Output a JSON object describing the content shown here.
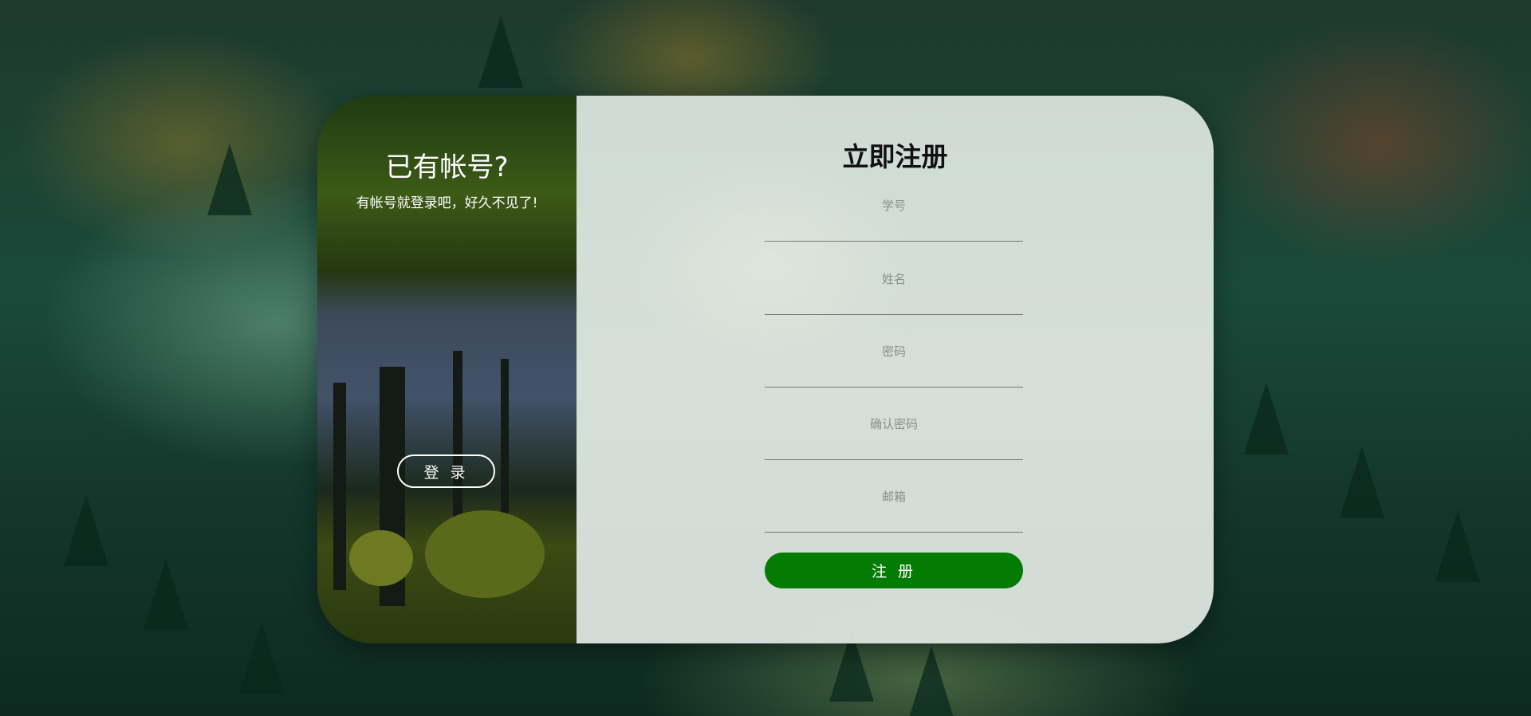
{
  "left_panel": {
    "title": "已有帐号?",
    "subtitle": "有帐号就登录吧，好久不见了!",
    "login_label": "登 录"
  },
  "right_panel": {
    "title": "立即注册",
    "fields": [
      {
        "placeholder": "学号"
      },
      {
        "placeholder": "姓名"
      },
      {
        "placeholder": "密码"
      },
      {
        "placeholder": "确认密码"
      },
      {
        "placeholder": "邮箱"
      }
    ],
    "register_label": "注 册"
  },
  "colors": {
    "accent": "#047c04"
  }
}
